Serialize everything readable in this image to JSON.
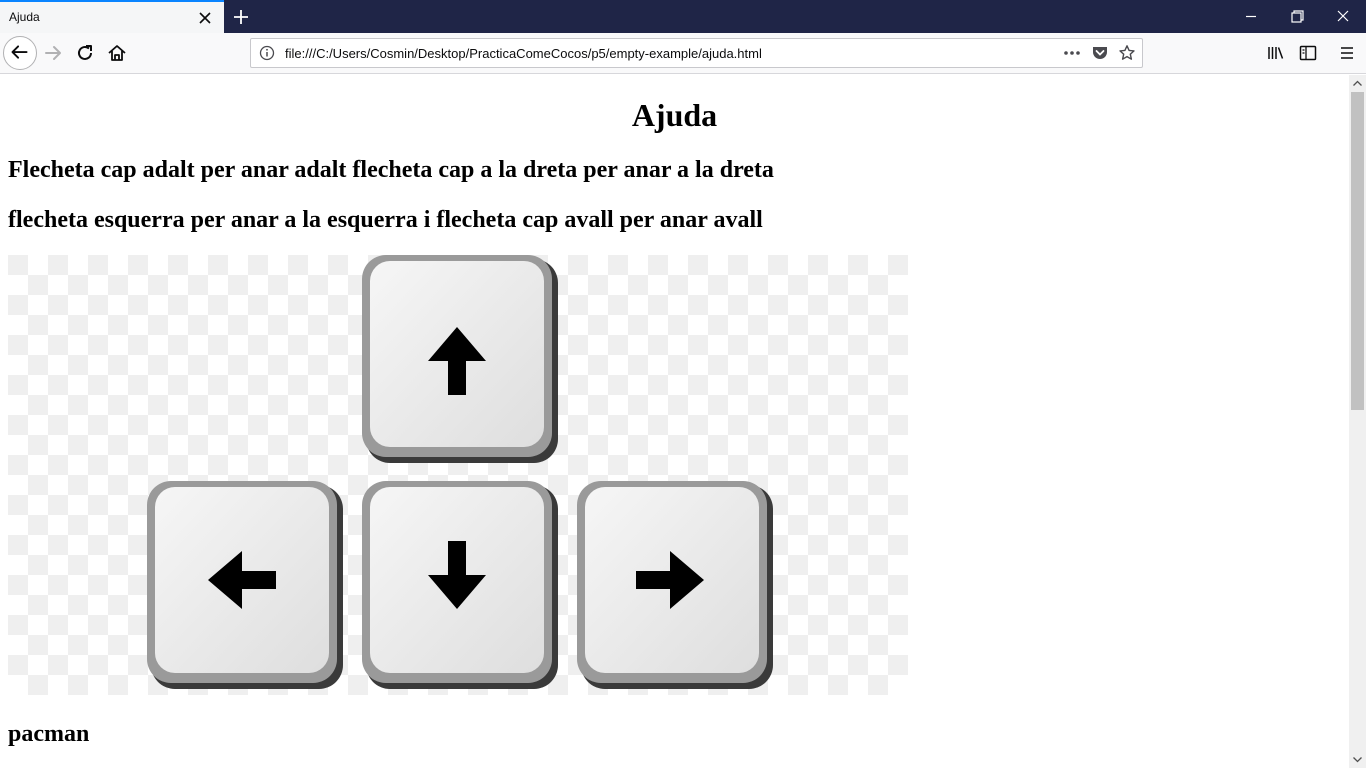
{
  "browser": {
    "tab": {
      "title": "Ajuda"
    },
    "url": "file:///C:/Users/Cosmin/Desktop/PracticaComeCocos/p5/empty-example/ajuda.html",
    "icons": {
      "tab_close": "close-icon",
      "new_tab": "plus-icon",
      "back": "arrow-left-icon",
      "forward": "arrow-right-icon",
      "reload": "reload-icon",
      "home": "home-icon",
      "site_info": "info-icon",
      "page_actions": "more-horizontal-icon",
      "pocket": "pocket-icon",
      "bookmark": "star-icon",
      "library": "library-icon",
      "sidebar": "sidebar-icon",
      "menu": "hamburger-menu-icon"
    },
    "colors": {
      "titlebar": "#1f2547",
      "active_tab_accent": "#0a84ff"
    }
  },
  "page": {
    "title": "Ajuda",
    "line1": "Flecheta cap adalt per anar adalt flecheta cap a la dreta per anar a la dreta",
    "line2": "flecheta esquerra per anar a la esquerra i flecheta cap avall per anar avall",
    "image": {
      "keys": [
        "arrow-up-key",
        "arrow-left-key",
        "arrow-down-key",
        "arrow-right-key"
      ]
    },
    "footer_label": "pacman"
  }
}
